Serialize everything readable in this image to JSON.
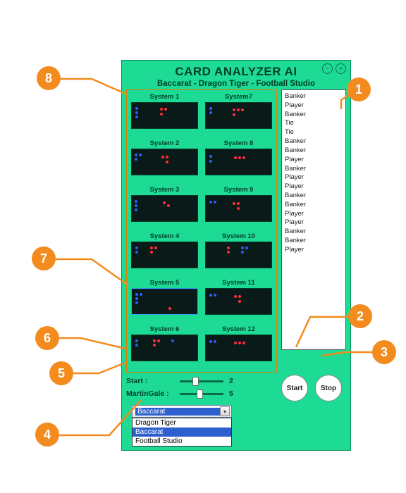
{
  "header": {
    "title": "CARD ANALYZER AI",
    "subtitle": "Baccarat - Dragon Tiger - Football Studio"
  },
  "window_controls": {
    "minimize": "−",
    "close": "×"
  },
  "systems": [
    {
      "label": "System 1"
    },
    {
      "label": "System7"
    },
    {
      "label": "System 2"
    },
    {
      "label": "System 8"
    },
    {
      "label": "System 3"
    },
    {
      "label": "System 9"
    },
    {
      "label": "System 4"
    },
    {
      "label": "System 10"
    },
    {
      "label": "System 5"
    },
    {
      "label": "System 11"
    },
    {
      "label": "System 6"
    },
    {
      "label": "System 12"
    }
  ],
  "history": [
    "Banker",
    "Player",
    "Banker",
    "Tie",
    "Tie",
    "Banker",
    "Banker",
    "Player",
    "Banker",
    "Player",
    "Player",
    "Banker",
    "Banker",
    "Player",
    "Player",
    "Banker",
    "Banker",
    "Player"
  ],
  "sliders": {
    "start": {
      "label": "Start :",
      "value": "2",
      "pos": 30
    },
    "martingale": {
      "label": "MartinGale :",
      "value": "5",
      "pos": 38
    }
  },
  "buttons": {
    "start": "Start",
    "stop": "Stop"
  },
  "dropdown": {
    "selected": "Baccarat",
    "options": [
      "Dragon Tiger",
      "Baccarat",
      "Football Studio"
    ]
  },
  "callouts": {
    "1": "1",
    "2": "2",
    "3": "3",
    "4": "4",
    "5": "5",
    "6": "6",
    "7": "7",
    "8": "8"
  }
}
